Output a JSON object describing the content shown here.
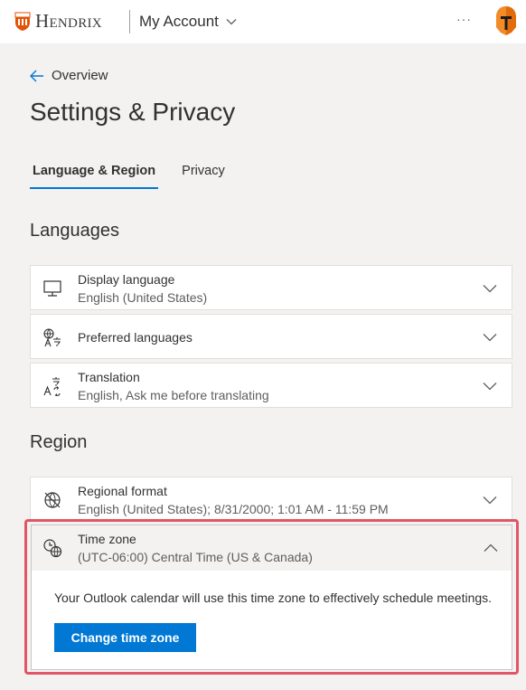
{
  "header": {
    "brand": "Hendrix",
    "app_title": "My Account",
    "more": "···"
  },
  "nav": {
    "back_label": "Overview"
  },
  "page": {
    "title": "Settings & Privacy"
  },
  "tabs": [
    {
      "label": "Language & Region",
      "active": true
    },
    {
      "label": "Privacy",
      "active": false
    }
  ],
  "languages": {
    "heading": "Languages",
    "items": [
      {
        "icon": "monitor-icon",
        "label": "Display language",
        "value": "English (United States)"
      },
      {
        "icon": "preferred-languages-icon",
        "label": "Preferred languages",
        "value": ""
      },
      {
        "icon": "translation-icon",
        "label": "Translation",
        "value": "English, Ask me before translating"
      }
    ]
  },
  "region": {
    "heading": "Region",
    "items": [
      {
        "icon": "globe-format-icon",
        "label": "Regional format",
        "value": "English (United States); 8/31/2000; 1:01 AM - 11:59 PM"
      }
    ],
    "timezone": {
      "icon": "clock-globe-icon",
      "label": "Time zone",
      "value": "(UTC-06:00) Central Time (US & Canada)",
      "description": "Your Outlook calendar will use this time zone to effectively schedule meetings.",
      "button": "Change time zone",
      "expanded": true
    }
  },
  "colors": {
    "accent": "#0078d4",
    "highlight": "#e25567",
    "brand": "#e35205"
  }
}
